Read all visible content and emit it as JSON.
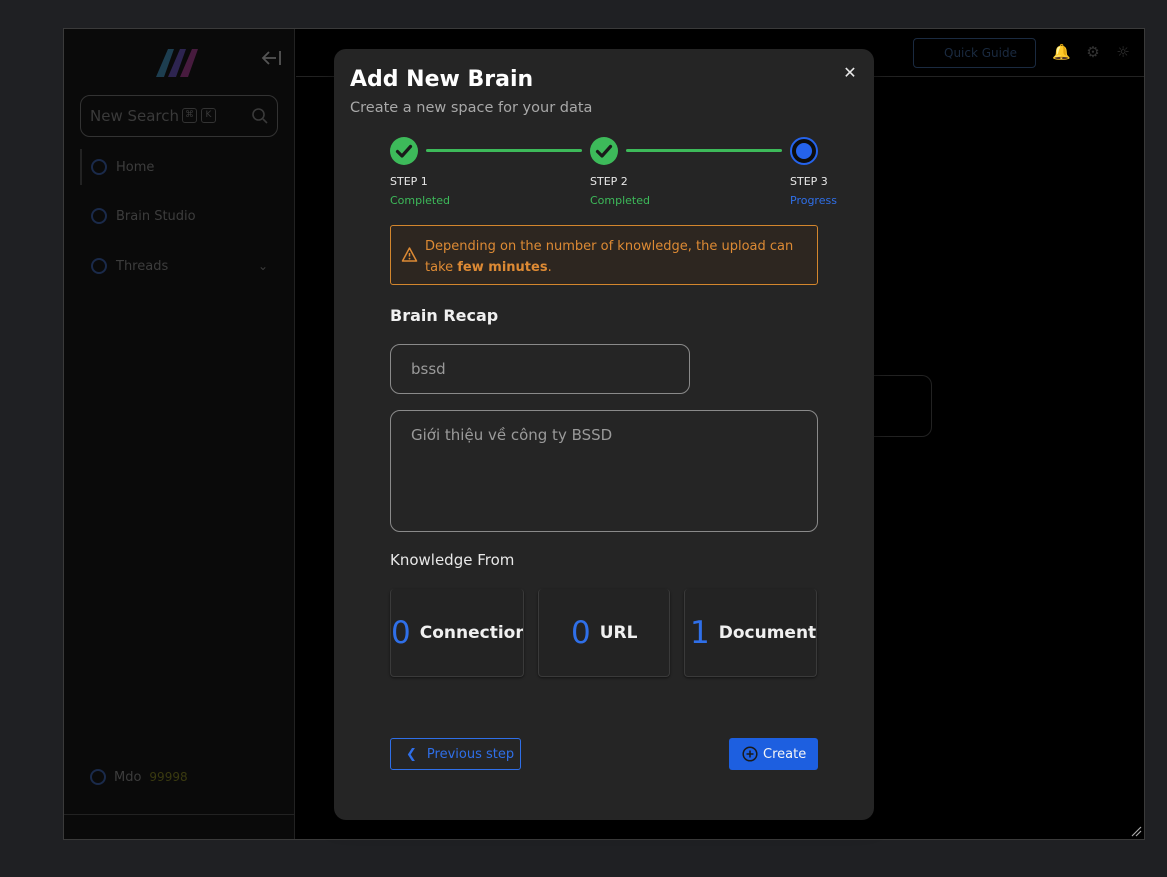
{
  "sidebar": {
    "search_label": "New Search",
    "search_kbd": [
      "⌘",
      "K"
    ],
    "items": [
      {
        "label": "Home",
        "icon": "home-icon"
      },
      {
        "label": "Brain Studio",
        "icon": "brain-studio-icon"
      },
      {
        "label": "Threads",
        "icon": "threads-icon"
      }
    ],
    "user": {
      "name": "Mdo",
      "credits": "99998"
    }
  },
  "header": {
    "button_label": "Quick Guide"
  },
  "modal": {
    "title": "Add New Brain",
    "subtitle": "Create a new space for your data",
    "steps": [
      {
        "label": "STEP 1",
        "status": "Completed"
      },
      {
        "label": "STEP 2",
        "status": "Completed"
      },
      {
        "label": "STEP 3",
        "status": "Progress"
      }
    ],
    "warning": {
      "text": "Depending on the number of knowledge, the upload can take ",
      "bold": "few minutes",
      "end": "."
    },
    "recap_title": "Brain Recap",
    "name_value": "bssd",
    "description_value": "Giới thiệu về công ty BSSD",
    "knowledge_title": "Knowledge From",
    "knowledge": [
      {
        "count": "0",
        "label": "Connection"
      },
      {
        "count": "0",
        "label": "URL"
      },
      {
        "count": "1",
        "label": "Document"
      }
    ],
    "prev_label": "Previous step",
    "create_label": "Create"
  },
  "colors": {
    "accent": "#2563eb",
    "success": "#3dba5a",
    "warning": "#dd8a34",
    "modal_bg": "#252525"
  }
}
